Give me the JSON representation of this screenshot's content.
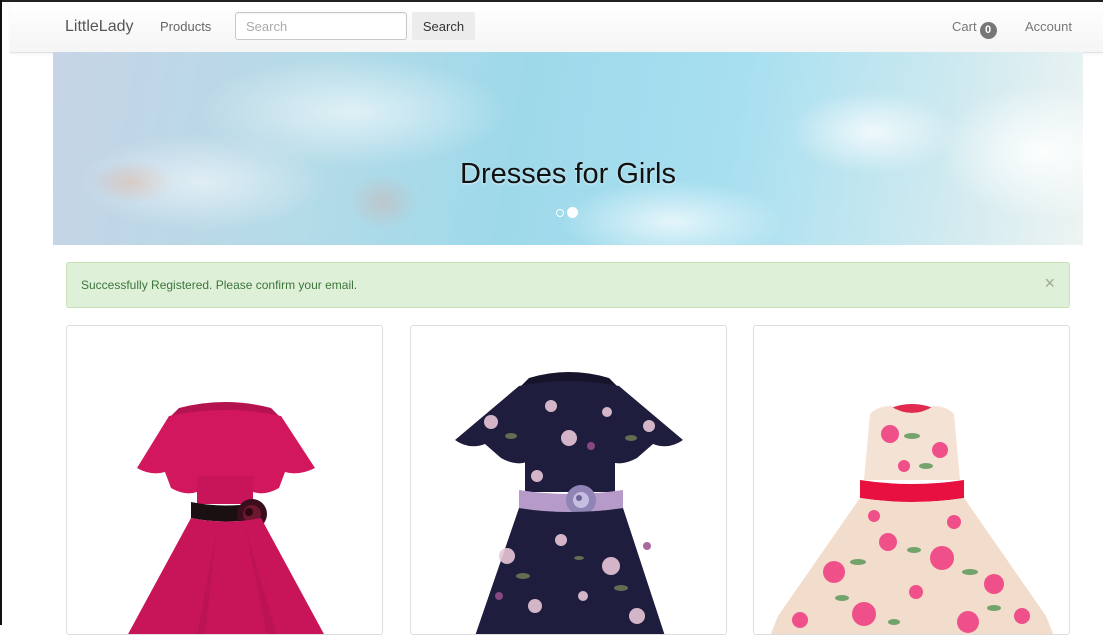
{
  "navbar": {
    "brand": "LittleLady",
    "products_label": "Products",
    "search_placeholder": "Search",
    "search_button": "Search",
    "cart_label": "Cart",
    "cart_count": "0",
    "account_label": "Account"
  },
  "hero": {
    "title": "Dresses for Girls",
    "slides": 2,
    "active_slide": 2
  },
  "alert": {
    "message": "Successfully Registered. Please confirm your email.",
    "close_symbol": "×",
    "color": "#dff0d8"
  },
  "products": [
    {
      "image": "pink-dress-with-flower-belt",
      "color": "#c8155a"
    },
    {
      "image": "navy-floral-dress-with-lilac-belt",
      "color": "#1e1d3e"
    },
    {
      "image": "white-rose-print-dress-with-red-belt",
      "color": "#f2dccb"
    }
  ]
}
